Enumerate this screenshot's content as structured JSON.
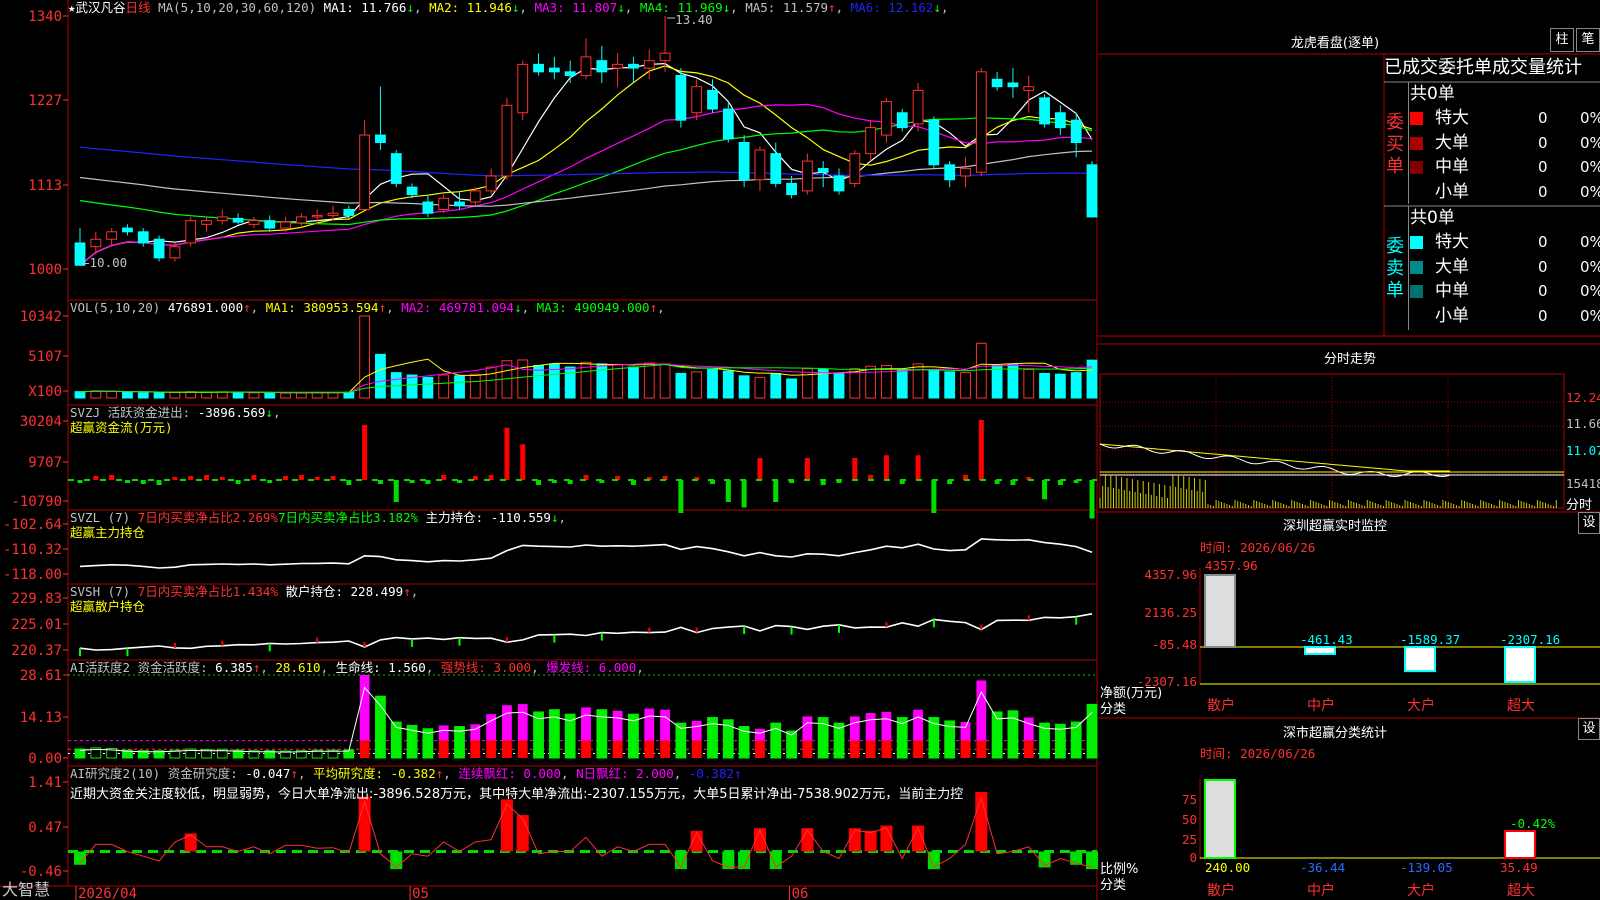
{
  "stock": {
    "prefix": "★",
    "name": "武汉凡谷",
    "period": "日线"
  },
  "indicators": {
    "ma_label": "MA(5,10,20,30,60,120)",
    "ma": [
      {
        "label": "MA1:",
        "value": "11.766",
        "arrow": "↓",
        "color": "#ffffff"
      },
      {
        "label": "MA2:",
        "value": "11.946",
        "arrow": "↓",
        "color": "#ffff00"
      },
      {
        "label": "MA3:",
        "value": "11.807",
        "arrow": "↓",
        "color": "#ff00ff"
      },
      {
        "label": "MA4:",
        "value": "11.969",
        "arrow": "↓",
        "color": "#00ff00"
      },
      {
        "label": "MA5:",
        "value": "11.579",
        "arrow": "↑",
        "color": "#c0c0c0"
      },
      {
        "label": "MA6:",
        "value": "12.162",
        "arrow": "↓",
        "color": "#2222ff"
      }
    ],
    "high_mark": "13.40",
    "low_mark": "←10.00",
    "vol_label": "VOL(5,10,20)",
    "vol_value": "476891.000",
    "vol_arrow": "↑",
    "vol_ma": [
      {
        "label": "MA1:",
        "value": "380953.594",
        "arrow": "↑",
        "color": "#ffff00"
      },
      {
        "label": "MA2:",
        "value": "469781.094",
        "arrow": "↓",
        "color": "#ff00ff"
      },
      {
        "label": "MA3:",
        "value": "490949.000",
        "arrow": "↑",
        "color": "#00ff00"
      }
    ],
    "svzj_label": "SVZJ 活跃资金进出:",
    "svzj_value": "-3896.569",
    "svzj_arrow": "↓",
    "svzj_title": "超赢资金流(万元)",
    "svzl_label": "SVZL (7)",
    "svzl_red": "7日内买卖净占比2.269%",
    "svzl_green": "7日内买卖净占比3.182%",
    "svzl_hold": "主力持仓:",
    "svzl_hold_value": "-110.559",
    "svzl_arrow": "↓",
    "svzl_title": "超赢主力持仓",
    "svsh_label": "SVSH (7)",
    "svsh_red": "7日内买卖净占比1.434%",
    "svsh_hold": "散户持仓:",
    "svsh_hold_value": "228.499",
    "svsh_arrow": "↑",
    "svsh_title": "超赢散户持仓",
    "ai1_label": "AI活跃度2 资金活跃度:",
    "ai1_value": "6.385",
    "ai1_arrow": "↑",
    "ai1_v2": "28.610",
    "ai1_life": "生命线:",
    "ai1_life_value": "1.560",
    "ai1_strong": "强势线: 3.000",
    "ai1_burst": "爆发线: 6.000",
    "ai2_label": "AI研究度2(10) 资金研究度:",
    "ai2_value": "-0.047",
    "ai2_arrow": "↑",
    "ai2_avg": "平均研究度:",
    "ai2_avg_value": "-0.382",
    "ai2_red": "连续飘红: 0.000",
    "ai2_n": "N日飘红: 2.000",
    "ai2_last": "-0.382",
    "ai2_text": "近期大资金关注度较低，明显弱势，今日大单净流出:-3896.528万元，其中特大单净流出:-2307.155万元，大单5日累计净出-7538.902万元，当前主力控"
  },
  "y_axes": {
    "price": [
      "1340",
      "1227",
      "1113",
      "1000"
    ],
    "vol": [
      "10342",
      "5107",
      "X100"
    ],
    "svzj": [
      "30204",
      "9707",
      "-10790"
    ],
    "svzl": [
      "-102.64",
      "-110.32",
      "-118.00"
    ],
    "svsh": [
      "229.83",
      "225.01",
      "220.37"
    ],
    "ai1": [
      "28.61",
      "14.13",
      "0.00"
    ],
    "ai2": [
      "1.41",
      "0.47",
      "-0.46"
    ]
  },
  "x_axis": {
    "labels": [
      "2026/04",
      "05",
      "06"
    ]
  },
  "brand": "大智慧",
  "right": {
    "lhb_title": "龙虎看盘(逐单)",
    "btn_zhu": "柱",
    "btn_bi": "笔",
    "tab_title": "已成交委托单成交量统计",
    "buy_side": "委买单",
    "sell_side": "委卖单",
    "buy_total": "共0单",
    "sell_total": "共0单",
    "buy_rows": [
      {
        "label": "特大",
        "value": "0",
        "pct": "0%",
        "color": "#ff0000"
      },
      {
        "label": "大单",
        "value": "0",
        "pct": "0%",
        "color": "#aa0000"
      },
      {
        "label": "中单",
        "value": "0",
        "pct": "0%",
        "color": "#800000"
      },
      {
        "label": "小单",
        "value": "0",
        "pct": "0%",
        "color": ""
      }
    ],
    "sell_rows": [
      {
        "label": "特大",
        "value": "0",
        "pct": "0%",
        "color": "#00ffff"
      },
      {
        "label": "大单",
        "value": "0",
        "pct": "0%",
        "color": "#008b8b"
      },
      {
        "label": "中单",
        "value": "0",
        "pct": "0%",
        "color": "#007070"
      },
      {
        "label": "小单",
        "value": "0",
        "pct": "0%",
        "color": ""
      }
    ],
    "intraday_title": "分时走势",
    "intraday_axis": [
      "12.24",
      "11.66",
      "11.07",
      "15418"
    ],
    "intraday_unit": "分时",
    "sz_monitor_title": "深圳超赢实时监控",
    "sz_btn": "设",
    "sz_time": "时间: 2026/06/26",
    "sz_axis": [
      "4357.96",
      "2136.25",
      "-85.48",
      "-2307.16"
    ],
    "sz_ylabel": "净额(万元)",
    "sz_xlabel": "分类",
    "sz_values": [
      {
        "cat": "散户",
        "value": 4357.96,
        "label": "4357.96"
      },
      {
        "cat": "中户",
        "value": -461.43,
        "label": "-461.43"
      },
      {
        "cat": "大户",
        "value": -1589.37,
        "label": "-1589.37"
      },
      {
        "cat": "超大",
        "value": -2307.16,
        "label": "-2307.16"
      }
    ],
    "class_title": "深市超赢分类统计",
    "class_btn": "设",
    "class_time": "时间: 2026/06/26",
    "class_axis": [
      "75",
      "50",
      "25",
      "0"
    ],
    "class_ylabel": "比例%",
    "class_xlabel": "分类",
    "class_top_label": "-0.42%",
    "class_values": [
      {
        "cat": "散户",
        "value": 240.0,
        "label": "240.00"
      },
      {
        "cat": "中户",
        "value": -36.44,
        "label": "-36.44"
      },
      {
        "cat": "大户",
        "value": -139.05,
        "label": "-139.05"
      },
      {
        "cat": "超大",
        "value": 35.49,
        "label": "35.49"
      }
    ]
  },
  "chart_data": [
    {
      "type": "candlestick",
      "title": "武汉凡谷 日线",
      "ylim": [
        10.0,
        13.4
      ],
      "ohlc": [
        [
          10.35,
          10.55,
          10.05,
          10.05
        ],
        [
          10.3,
          10.5,
          10.2,
          10.4
        ],
        [
          10.4,
          10.55,
          10.3,
          10.5
        ],
        [
          10.55,
          10.6,
          10.45,
          10.5
        ],
        [
          10.5,
          10.55,
          10.3,
          10.35
        ],
        [
          10.4,
          10.45,
          10.1,
          10.15
        ],
        [
          10.15,
          10.35,
          10.1,
          10.3
        ],
        [
          10.35,
          10.7,
          10.3,
          10.65
        ],
        [
          10.6,
          10.7,
          10.5,
          10.65
        ],
        [
          10.65,
          10.8,
          10.6,
          10.7
        ],
        [
          10.68,
          10.75,
          10.6,
          10.63
        ],
        [
          10.6,
          10.7,
          10.55,
          10.65
        ],
        [
          10.65,
          10.72,
          10.5,
          10.55
        ],
        [
          10.55,
          10.7,
          10.5,
          10.63
        ],
        [
          10.62,
          10.75,
          10.58,
          10.7
        ],
        [
          10.7,
          10.8,
          10.6,
          10.72
        ],
        [
          10.72,
          10.85,
          10.65,
          10.75
        ],
        [
          10.8,
          10.85,
          10.68,
          10.72
        ],
        [
          10.8,
          12.0,
          10.8,
          11.8
        ],
        [
          11.8,
          12.45,
          11.6,
          11.7
        ],
        [
          11.55,
          11.6,
          11.1,
          11.15
        ],
        [
          11.1,
          11.15,
          10.95,
          11.0
        ],
        [
          10.9,
          11.0,
          10.7,
          10.75
        ],
        [
          10.8,
          11.0,
          10.75,
          10.95
        ],
        [
          10.9,
          11.05,
          10.8,
          10.85
        ],
        [
          10.9,
          11.1,
          10.85,
          11.05
        ],
        [
          11.05,
          11.35,
          11.0,
          11.25
        ],
        [
          11.25,
          12.3,
          11.2,
          12.2
        ],
        [
          12.1,
          12.8,
          12.0,
          12.75
        ],
        [
          12.75,
          12.9,
          12.6,
          12.65
        ],
        [
          12.7,
          12.85,
          12.55,
          12.65
        ],
        [
          12.65,
          12.8,
          12.5,
          12.6
        ],
        [
          12.6,
          13.1,
          12.55,
          12.85
        ],
        [
          12.8,
          13.0,
          12.5,
          12.65
        ],
        [
          12.7,
          12.9,
          12.45,
          12.75
        ],
        [
          12.75,
          12.85,
          12.5,
          12.7
        ],
        [
          12.7,
          12.95,
          12.55,
          12.8
        ],
        [
          12.8,
          13.4,
          12.65,
          12.9
        ],
        [
          12.6,
          12.7,
          11.9,
          12.0
        ],
        [
          12.1,
          12.55,
          12.0,
          12.45
        ],
        [
          12.4,
          12.55,
          12.1,
          12.15
        ],
        [
          12.15,
          12.25,
          11.7,
          11.75
        ],
        [
          11.7,
          11.8,
          11.1,
          11.2
        ],
        [
          11.2,
          11.65,
          11.05,
          11.6
        ],
        [
          11.55,
          11.7,
          11.1,
          11.15
        ],
        [
          11.15,
          11.25,
          10.95,
          11.0
        ],
        [
          11.05,
          11.55,
          11.0,
          11.45
        ],
        [
          11.35,
          11.45,
          11.1,
          11.3
        ],
        [
          11.25,
          11.35,
          11.0,
          11.05
        ],
        [
          11.15,
          11.6,
          11.1,
          11.55
        ],
        [
          11.55,
          12.0,
          11.45,
          11.9
        ],
        [
          11.8,
          12.3,
          11.7,
          12.25
        ],
        [
          12.1,
          12.15,
          11.85,
          11.9
        ],
        [
          11.95,
          12.5,
          11.85,
          12.4
        ],
        [
          12.0,
          12.05,
          11.35,
          11.4
        ],
        [
          11.4,
          11.45,
          11.1,
          11.2
        ],
        [
          11.25,
          11.5,
          11.1,
          11.35
        ],
        [
          11.3,
          12.7,
          11.25,
          12.65
        ],
        [
          12.55,
          12.65,
          12.4,
          12.45
        ],
        [
          12.5,
          12.7,
          12.3,
          12.45
        ],
        [
          12.4,
          12.6,
          12.1,
          12.45
        ],
        [
          12.3,
          12.35,
          11.9,
          11.95
        ],
        [
          12.1,
          12.2,
          11.8,
          11.9
        ],
        [
          12.0,
          12.1,
          11.5,
          11.7
        ],
        [
          11.4,
          11.45,
          10.7,
          10.7
        ]
      ]
    },
    {
      "type": "bar",
      "title": "VOL(5,10,20)",
      "ylim": [
        0,
        10342
      ],
      "values": [
        800,
        900,
        850,
        700,
        650,
        650,
        700,
        800,
        750,
        780,
        700,
        650,
        650,
        620,
        650,
        700,
        700,
        720,
        10342,
        5500,
        3200,
        2900,
        2600,
        2900,
        2800,
        3000,
        3900,
        4700,
        4800,
        4100,
        4300,
        3900,
        4500,
        4300,
        4200,
        3900,
        4400,
        4300,
        3100,
        3300,
        3600,
        3400,
        2800,
        2600,
        3100,
        2400,
        3700,
        3600,
        3100,
        3700,
        4000,
        4100,
        3600,
        4300,
        3600,
        3300,
        3200,
        6900,
        4100,
        4200,
        3600,
        3100,
        3000,
        3200,
        4768
      ]
    }
  ]
}
